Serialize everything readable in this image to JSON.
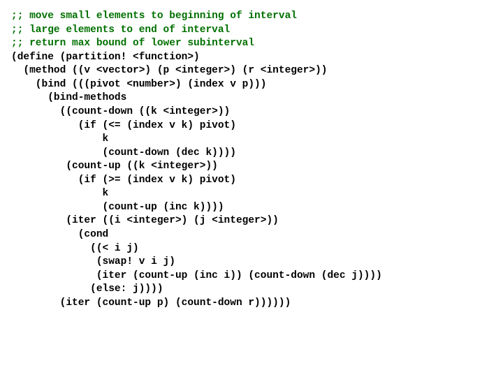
{
  "code": {
    "comment_lines": [
      ";; move small elements to beginning of interval",
      ";; large elements to end of interval",
      ";; return max bound of lower subinterval"
    ],
    "body_lines": [
      "(define (partition! <function>)",
      "  (method ((v <vector>) (p <integer>) (r <integer>))",
      "    (bind (((pivot <number>) (index v p)))",
      "      (bind-methods",
      "        ((count-down ((k <integer>))",
      "           (if (<= (index v k) pivot)",
      "               k",
      "               (count-down (dec k))))",
      "         (count-up ((k <integer>))",
      "           (if (>= (index v k) pivot)",
      "               k",
      "               (count-up (inc k))))",
      "         (iter ((i <integer>) (j <integer>))",
      "           (cond",
      "             ((< i j)",
      "              (swap! v i j)",
      "              (iter (count-up (inc i)) (count-down (dec j))))",
      "             (else: j))))",
      "        (iter (count-up p) (count-down r))))))"
    ]
  }
}
